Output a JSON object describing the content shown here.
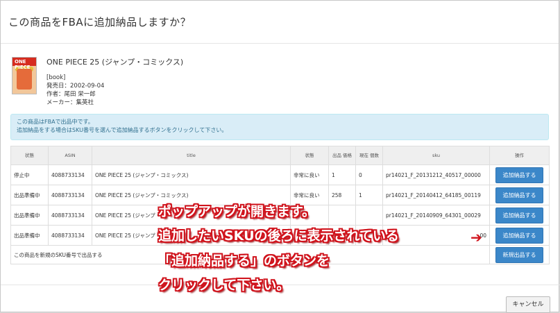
{
  "modal": {
    "title": "この商品をFBAに追加納品しますか？"
  },
  "product": {
    "title": "ONE PIECE 25 (ジャンプ・コミックス)",
    "type": "[book]",
    "release": "発売日：2002-09-04",
    "author": "作者：尾田 栄一郎",
    "maker": "メーカー：集英社"
  },
  "alert": {
    "line1": "この商品はFBAで出品中です。",
    "line2": "追加納品をする場合はSKU番号を選んで追加納品するボタンをクリックして下さい。"
  },
  "table": {
    "headers": [
      "状態",
      "ASIN",
      "title",
      "状態",
      "出品 価格",
      "現在 個数",
      "sku",
      "操作"
    ],
    "rows": [
      {
        "status": "停止中",
        "asin": "4088733134",
        "title": "ONE PIECE 25 (ジャンプ・コミックス)",
        "condition": "非常に良い",
        "price": "1",
        "qty": "0",
        "sku": "pr14021_F_20131212_40517_00000",
        "action": "追加納品する"
      },
      {
        "status": "出品準備中",
        "asin": "4088733134",
        "title": "ONE PIECE 25 (ジャンプ・コミックス)",
        "condition": "非常に良い",
        "price": "258",
        "qty": "1",
        "sku": "pr14021_F_20140412_64185_00119",
        "action": "追加納品する"
      },
      {
        "status": "出品準備中",
        "asin": "4088733134",
        "title": "ONE PIECE 25 (ジャンプ・",
        "condition": "",
        "price": "",
        "qty": "",
        "sku": "pr14021_F_20140909_64301_00029",
        "action": "追加納品する"
      },
      {
        "status": "出品準備中",
        "asin": "4088733134",
        "title": "ONE PIECE 25 (ジャンプ・",
        "condition": "",
        "price": "",
        "qty": "",
        "sku": "00",
        "action": "追加納品する"
      }
    ],
    "new_row_label": "この商品を新規のSKU番号で出品する",
    "new_button": "新規出品する"
  },
  "footer": {
    "cancel_label": "キャンセル"
  },
  "annotation": {
    "line1": "ポップアップが開きます。",
    "line2": "追加したいSKUの後ろに表示されている",
    "line3": "「追加納品する」のボタンを",
    "line4": "クリックして下さい。",
    "arrow": "➔",
    "color": "#d0131c"
  }
}
